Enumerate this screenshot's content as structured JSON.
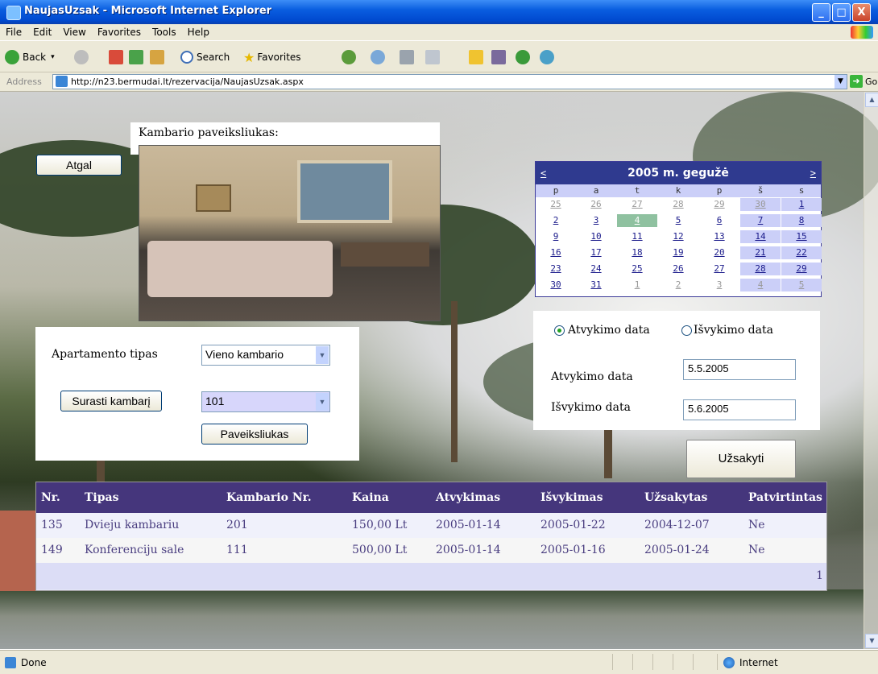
{
  "window": {
    "title": "NaujasUzsak - Microsoft Internet Explorer",
    "min": "_",
    "max": "□",
    "close": "X"
  },
  "menu": [
    "File",
    "Edit",
    "View",
    "Favorites",
    "Tools",
    "Help"
  ],
  "toolbar": {
    "back": "Back",
    "search": "Search",
    "favorites": "Favorites"
  },
  "address": {
    "label": "Address",
    "url": "http://n23.bermudai.lt/rezervacija/NaujasUzsak.aspx",
    "go": "Go"
  },
  "page": {
    "back_button": "Atgal",
    "picture_label": "Kambario paveiksliukas:",
    "apartment_label": "Apartamento tipas",
    "apartment_type": "Vieno kambario",
    "find_button": "Surasti kambarį",
    "room_number": "101",
    "picture_button": "Paveiksliukas",
    "radio_arrival": "Atvykimo data",
    "radio_departure": "Išvykimo data",
    "arrival_label": "Atvykimo data",
    "arrival_value": "5.5.2005",
    "departure_label": "Išvykimo data",
    "departure_value": "5.6.2005",
    "order_button": "Užsakyti"
  },
  "calendar": {
    "title": "2005 m. gegužė",
    "prev": "<",
    "next": ">",
    "dow": [
      "p",
      "a",
      "t",
      "k",
      "p",
      "š",
      "s"
    ],
    "weeks": [
      [
        "25",
        "26",
        "27",
        "28",
        "29",
        "30",
        "1"
      ],
      [
        "2",
        "3",
        "4",
        "5",
        "6",
        "7",
        "8"
      ],
      [
        "9",
        "10",
        "11",
        "12",
        "13",
        "14",
        "15"
      ],
      [
        "16",
        "17",
        "18",
        "19",
        "20",
        "21",
        "22"
      ],
      [
        "23",
        "24",
        "25",
        "26",
        "27",
        "28",
        "29"
      ],
      [
        "30",
        "31",
        "1",
        "2",
        "3",
        "4",
        "5"
      ]
    ],
    "selected_day": "4",
    "colors": {
      "header": "#2f3a8f",
      "weekend": "#cbcff8",
      "selected": "#8fc1a0"
    }
  },
  "grid": {
    "headers": [
      "Nr.",
      "Tipas",
      "Kambario Nr.",
      "Kaina",
      "Atvykimas",
      "Išvykimas",
      "Užsakytas",
      "Patvirtintas"
    ],
    "rows": [
      [
        "135",
        "Dvieju kambariu",
        "201",
        "150,00 Lt",
        "2005-01-14",
        "2005-01-22",
        "2004-12-07",
        "Ne"
      ],
      [
        "149",
        "Konferenciju sale",
        "111",
        "500,00 Lt",
        "2005-01-14",
        "2005-01-16",
        "2005-01-24",
        "Ne"
      ]
    ],
    "pager": "1",
    "colors": {
      "header": "#45367c",
      "row_text": "#4a3e80"
    }
  },
  "status": {
    "text": "Done",
    "zone": "Internet"
  }
}
